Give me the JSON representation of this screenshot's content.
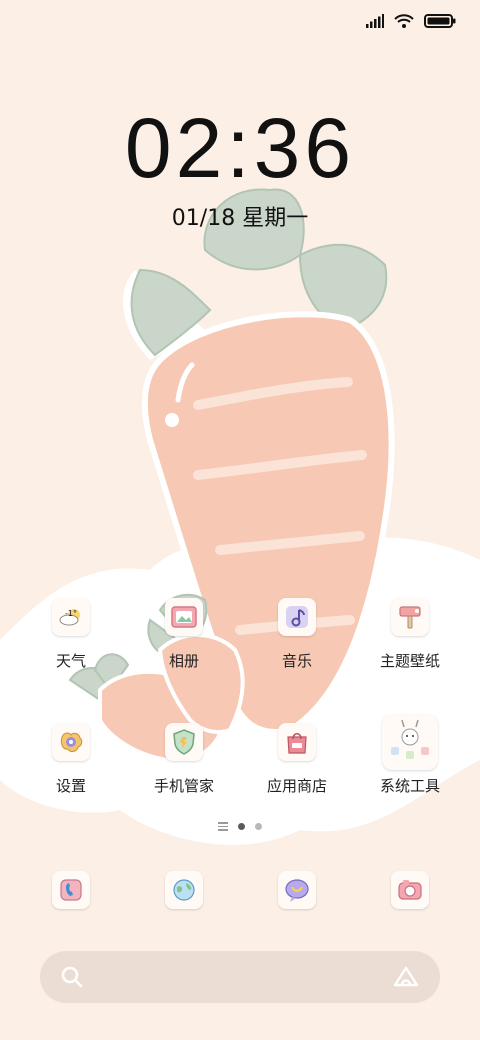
{
  "clock": {
    "time": "02:36",
    "date": "01/18 星期一"
  },
  "pages": {
    "count": 2,
    "active": 0
  },
  "home": {
    "row1": [
      {
        "label": "天气",
        "icon": "weather-icon"
      },
      {
        "label": "相册",
        "icon": "gallery-icon"
      },
      {
        "label": "音乐",
        "icon": "music-icon"
      },
      {
        "label": "主题壁纸",
        "icon": "themes-icon"
      }
    ],
    "row2": [
      {
        "label": "设置",
        "icon": "settings-icon"
      },
      {
        "label": "手机管家",
        "icon": "security-icon"
      },
      {
        "label": "应用商店",
        "icon": "app-store-icon"
      },
      {
        "label": "系统工具",
        "icon": "tools-folder-icon"
      }
    ],
    "weather_temp": "-1°"
  },
  "dock": [
    "phone-icon",
    "browser-icon",
    "messages-icon",
    "camera-icon"
  ],
  "colors": {
    "background": "#fcefe6",
    "carrot": "#f7c8b3",
    "leaf": "#c9d6c9",
    "cloud": "#ffffff"
  }
}
